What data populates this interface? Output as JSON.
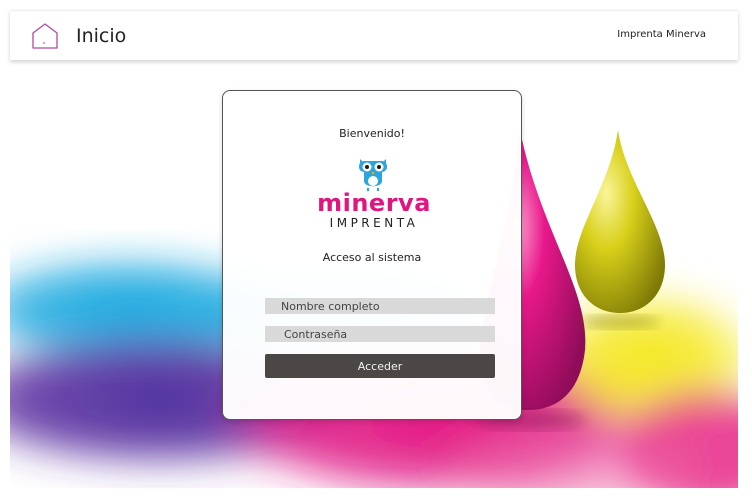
{
  "header": {
    "title": "Inicio",
    "home_icon": "home-icon",
    "brand_link": "Imprenta Minerva"
  },
  "login": {
    "welcome": "Bienvenido!",
    "logo": {
      "word": "minerva",
      "subword": "IMPRENTA",
      "icon": "owl-icon",
      "colors": {
        "pink": "#e0157e",
        "blue": "#2aa6dc",
        "dark": "#222222"
      }
    },
    "section_title": "Acceso al sistema",
    "name_field": {
      "placeholder": "Nombre completo",
      "value": ""
    },
    "password_field": {
      "placeholder": "Contraseña",
      "value": ""
    },
    "submit_label": "Acceder"
  },
  "theme": {
    "button_bg": "#4a4746",
    "field_bg": "#d9d9d9",
    "header_icon_color": "#b04aa0"
  }
}
